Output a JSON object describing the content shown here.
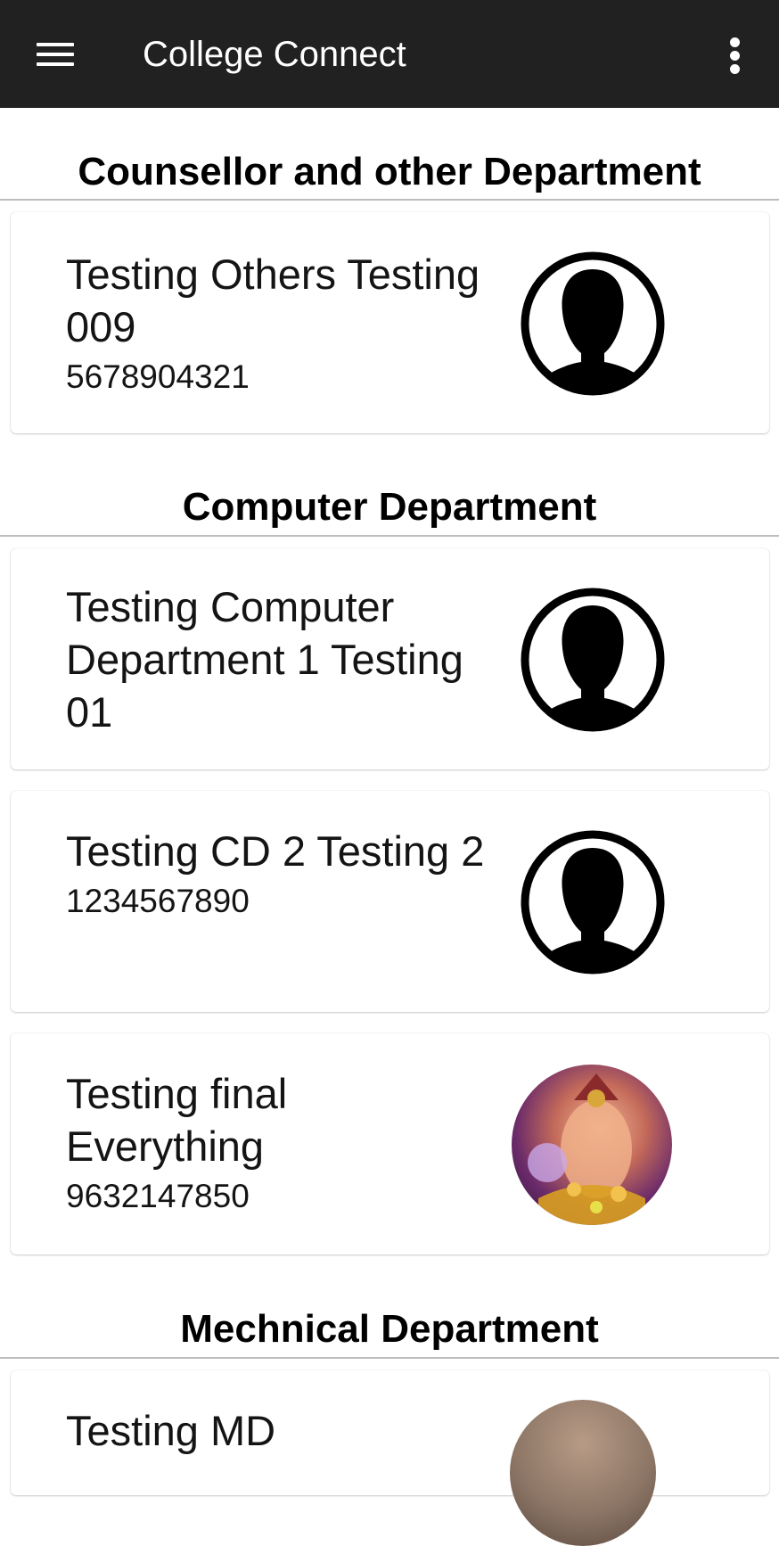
{
  "appbar": {
    "title": "College Connect",
    "menu_icon": "menu-icon",
    "more_icon": "more-vert-icon",
    "background": "#212121"
  },
  "sections": [
    {
      "heading": "Counsellor and other Department",
      "cards": [
        {
          "name": "Testing Others Testing 009",
          "phone": "5678904321",
          "avatar": "default-person-icon"
        }
      ]
    },
    {
      "heading": "Computer Department",
      "cards": [
        {
          "name": "Testing Computer Department 1 Testing 01",
          "phone": "",
          "avatar": "default-person-icon"
        },
        {
          "name": "Testing CD 2 Testing 2",
          "phone": "1234567890",
          "avatar": "default-person-icon"
        },
        {
          "name": "Testing final Everything",
          "phone": "9632147850",
          "avatar": "photo"
        }
      ]
    },
    {
      "heading": "Mechnical Department",
      "cards": [
        {
          "name": "Testing MD",
          "phone": "",
          "avatar": "photo"
        }
      ]
    }
  ]
}
